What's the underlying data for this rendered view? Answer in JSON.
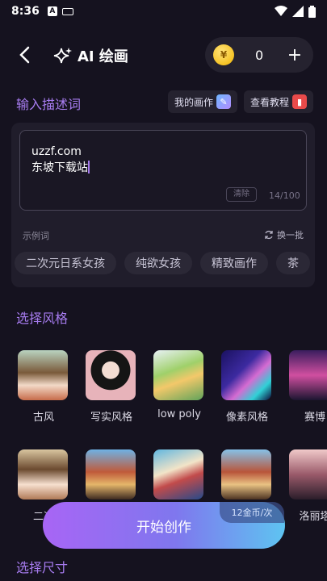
{
  "status_bar": {
    "time": "8:36"
  },
  "header": {
    "title": "AI 绘画",
    "coins": "0"
  },
  "input_section": {
    "label": "输入描述词",
    "my_paintings": "我的画作",
    "tutorial": "查看教程"
  },
  "prompt": {
    "line1": "uzzf.com",
    "line2": "东坡下载站",
    "clear": "清除",
    "count": "14/100",
    "examples_label": "示例词",
    "refresh": "换一批",
    "tags": [
      "二次元日系女孩",
      "纯欲女孩",
      "精致画作",
      "茶"
    ]
  },
  "style_section": {
    "label": "选择风格",
    "row1": [
      "古风",
      "写实风格",
      "low poly",
      "像素风格",
      "赛博"
    ],
    "row2": [
      "二次",
      "",
      "",
      "",
      "洛丽塔"
    ]
  },
  "size_section": {
    "label": "选择尺寸"
  },
  "cta": {
    "label": "开始创作",
    "cost": "12金币/次"
  },
  "colors": {
    "accent": "#a77cf0",
    "background": "#15121f",
    "card": "#201d2b"
  }
}
